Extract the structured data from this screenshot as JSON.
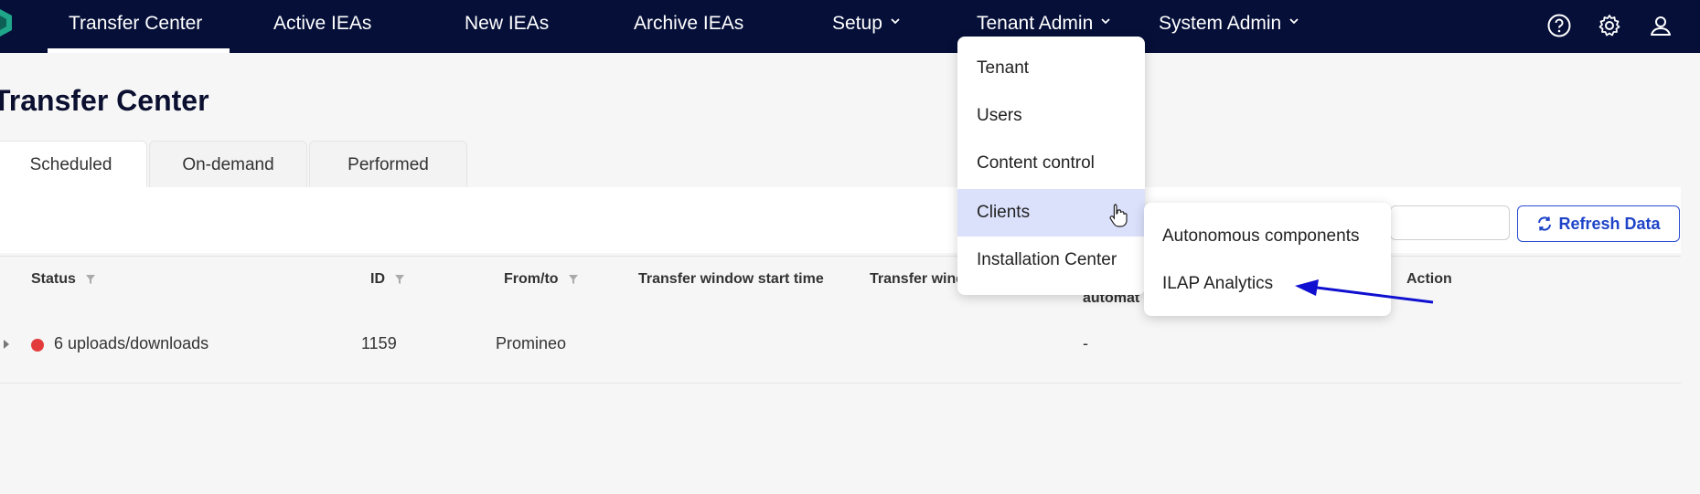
{
  "nav": {
    "items": [
      {
        "label": "Transfer Center",
        "active": true
      },
      {
        "label": "Active IEAs"
      },
      {
        "label": "New IEAs"
      },
      {
        "label": "Archive IEAs"
      },
      {
        "label": "Setup",
        "has_chevron": true
      },
      {
        "label": "Tenant Admin",
        "has_chevron": true
      },
      {
        "label": "System Admin",
        "has_chevron": true
      }
    ],
    "icons": [
      "help-icon",
      "gear-icon",
      "user-icon"
    ]
  },
  "page": {
    "title": "Transfer Center",
    "tabs": [
      {
        "label": "Scheduled",
        "active": true
      },
      {
        "label": "On-demand"
      },
      {
        "label": "Performed"
      }
    ],
    "refresh_label": "Refresh Data"
  },
  "table": {
    "columns": [
      "Status",
      "ID",
      "From/to",
      "Transfer window start time",
      "Transfer wind",
      "automat",
      "Action"
    ],
    "rows": [
      {
        "status": "6 uploads/downloads",
        "status_color": "#e33b3b",
        "id": "1159",
        "from_to": "Promineo",
        "automation": "-"
      }
    ]
  },
  "tenant_admin_menu": {
    "items": [
      "Tenant",
      "Users",
      "Content control",
      "Clients",
      "Installation Center"
    ],
    "highlighted": "Clients"
  },
  "clients_submenu": {
    "items": [
      "Autonomous components",
      "ILAP Analytics"
    ]
  },
  "colors": {
    "nav_bg": "#050f38",
    "accent": "#1f44c8",
    "highlight": "#dbe1fb",
    "annotation_arrow": "#1010d0"
  }
}
